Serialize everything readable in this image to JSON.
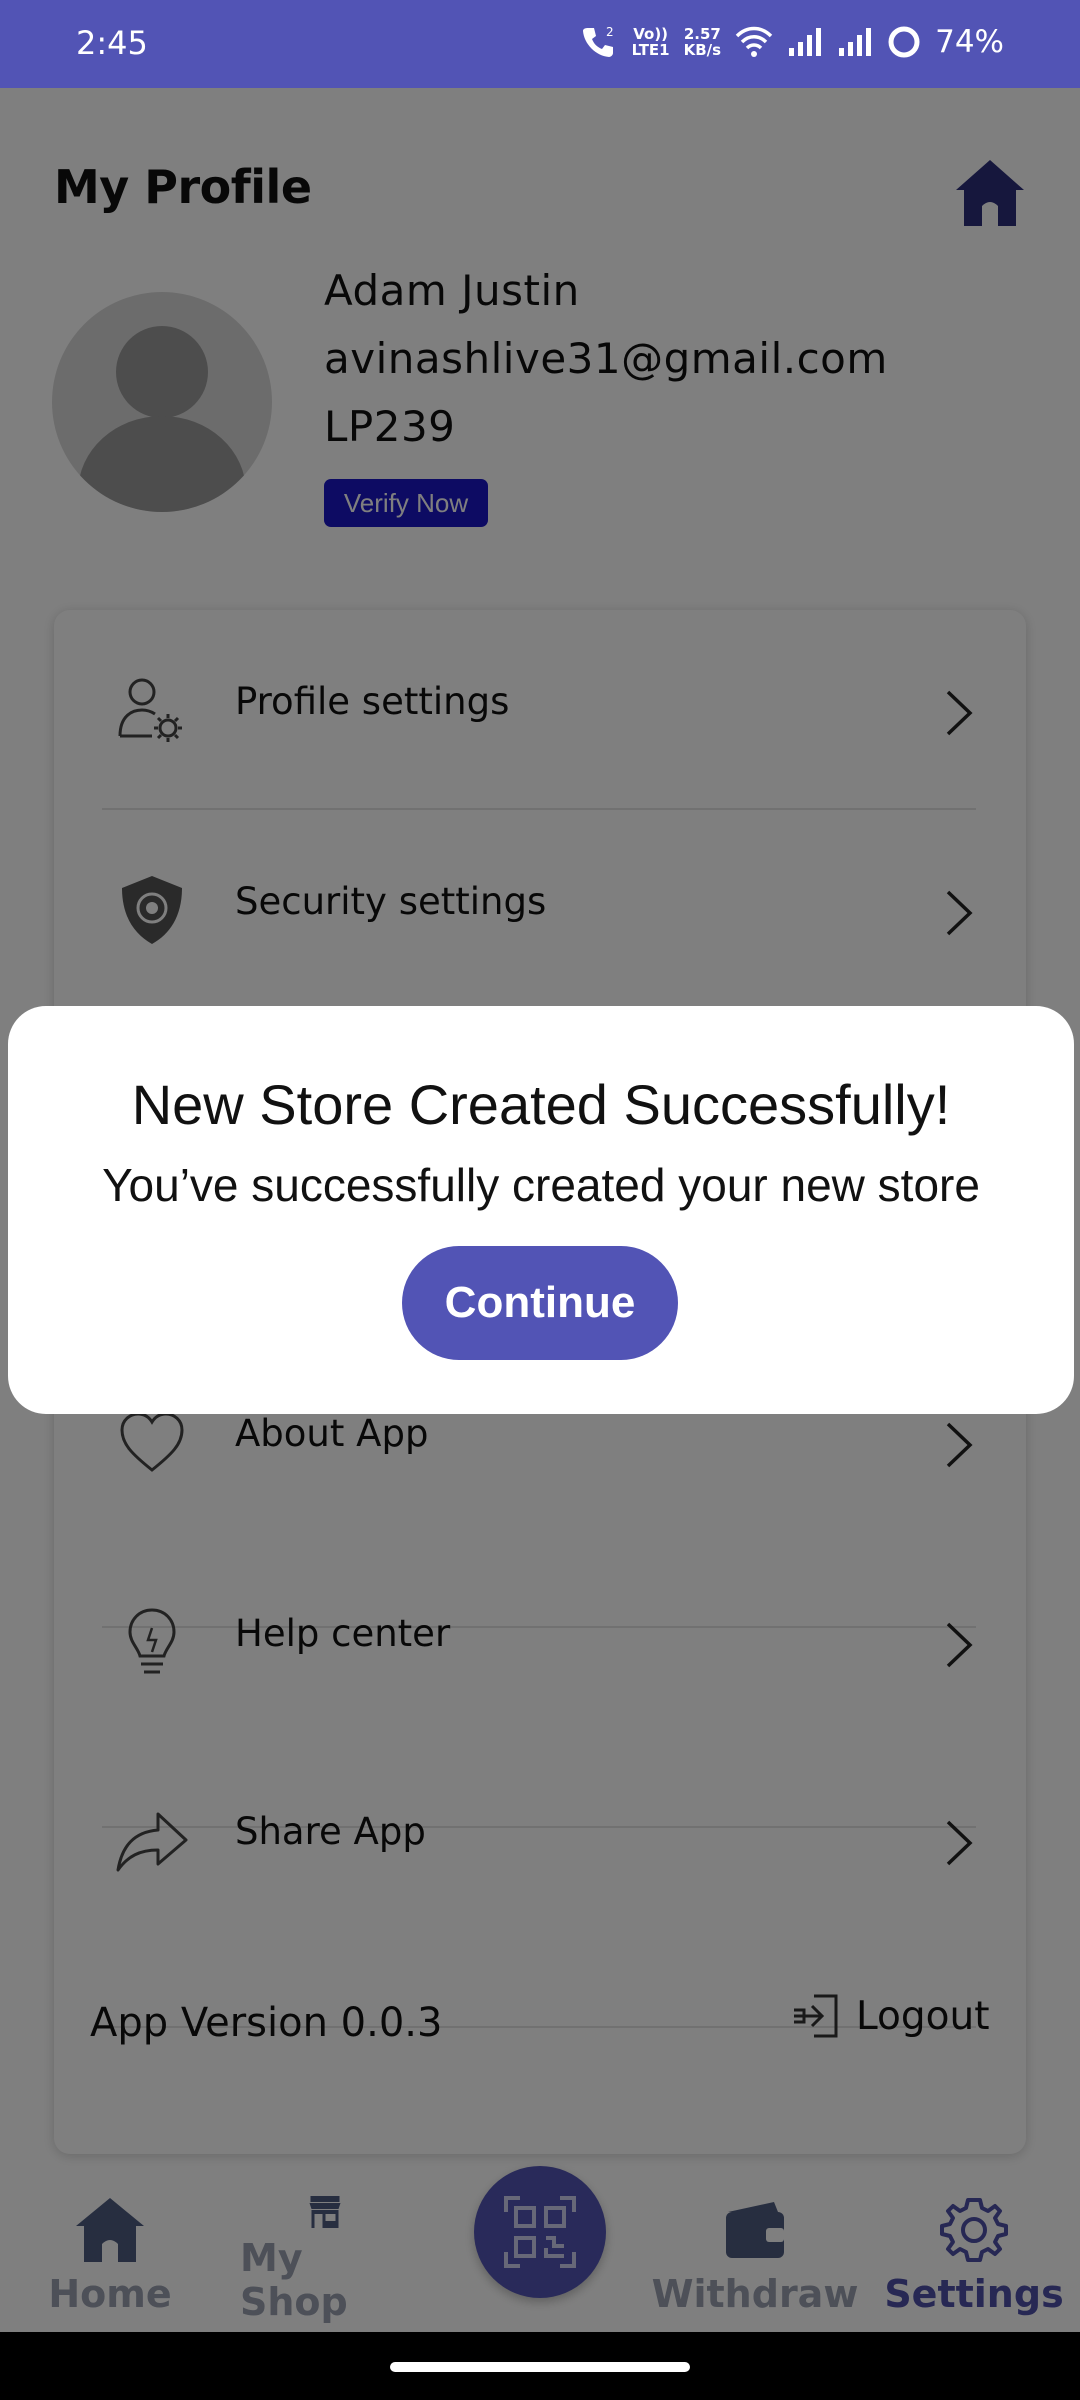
{
  "status_bar": {
    "time": "2:45",
    "volte_top": "Vo))",
    "volte_bottom": "LTE1",
    "net_speed_top": "2.57",
    "net_speed_bottom": "KB/s",
    "battery": "74%"
  },
  "header": {
    "title": "My Profile",
    "home_icon": "home-icon"
  },
  "profile": {
    "name": "Adam Justin",
    "email": "avinashlive31@gmail.com",
    "code": "LP239",
    "verify_label": "Verify Now"
  },
  "menu": {
    "items": [
      {
        "label": "Profile settings",
        "icon": "user-gear-icon"
      },
      {
        "label": "Security settings",
        "icon": "shield-icon"
      },
      {
        "label": "About App",
        "icon": "heart-icon"
      },
      {
        "label": "Help center",
        "icon": "lightbulb-icon"
      },
      {
        "label": "Share App",
        "icon": "share-arrow-icon"
      }
    ],
    "version": "App Version 0.0.3",
    "logout_label": "Logout"
  },
  "bottom_nav": {
    "items": [
      {
        "label": "Home",
        "icon": "home-icon"
      },
      {
        "label": "My Shop",
        "icon": "shop-icon"
      },
      {
        "label": "Withdraw",
        "icon": "wallet-icon"
      },
      {
        "label": "Settings",
        "icon": "gear-icon"
      }
    ],
    "active": "Settings",
    "center_icon": "qr-code-icon"
  },
  "dialog": {
    "title": "New Store Created Successfully!",
    "message": "You’ve successfully created your new store",
    "button_label": "Continue"
  },
  "colors": {
    "primary": "#5254b5",
    "verify": "#1b16c7",
    "nav_active": "#4e50a8",
    "nav_inactive": "#9aa0b0"
  }
}
